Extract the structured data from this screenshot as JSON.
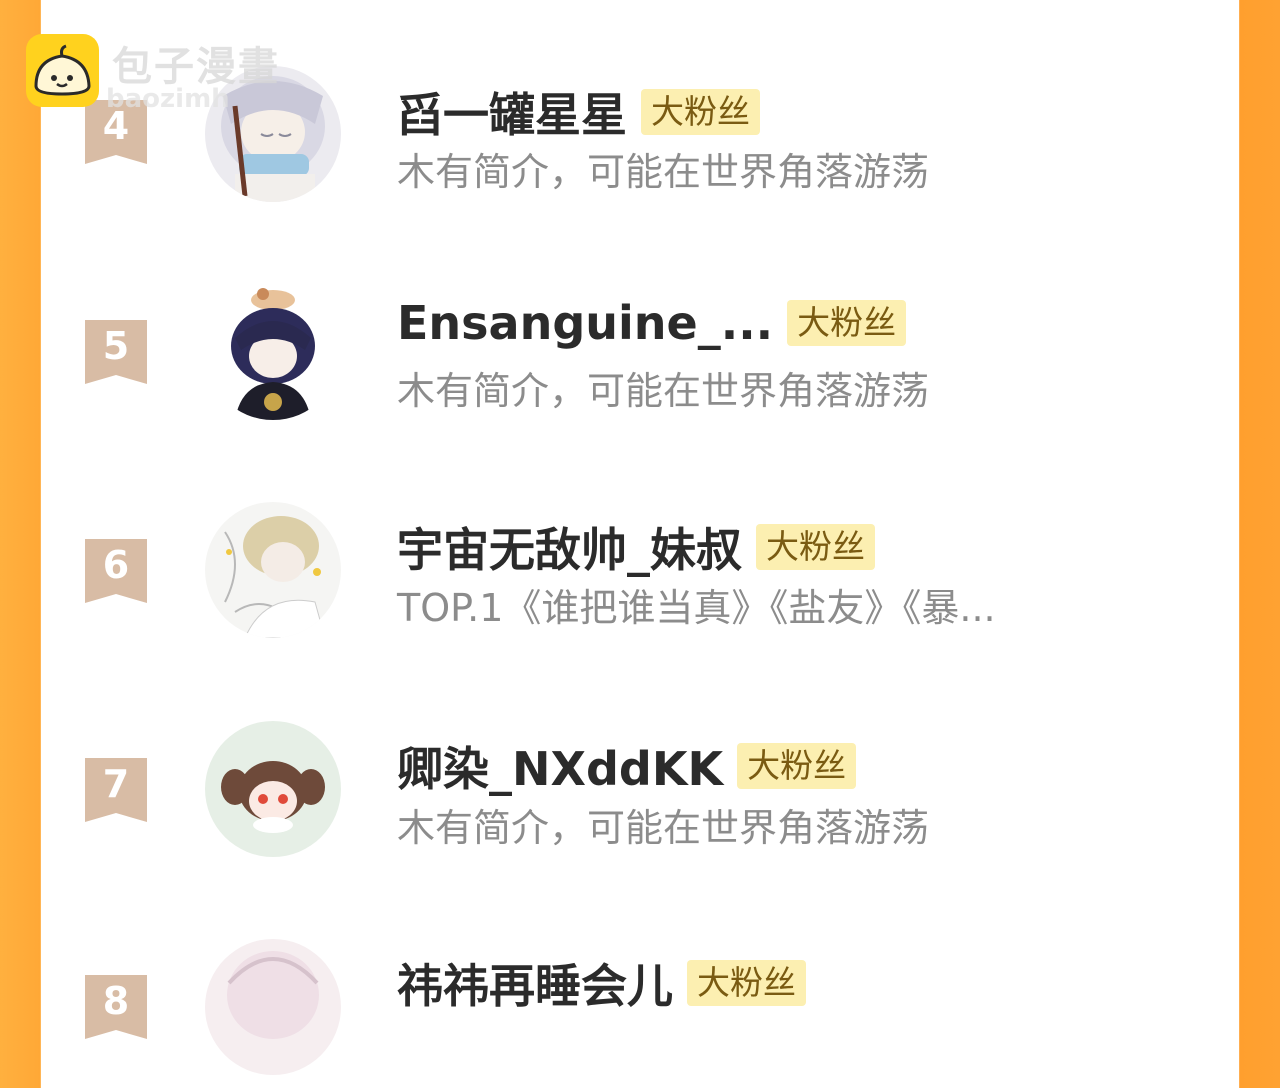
{
  "watermark": {
    "brand": "包子漫畫",
    "domain": "baozimh"
  },
  "rows": [
    {
      "rank": "4",
      "name": "舀一罐星星",
      "badge": "大粉丝",
      "bio": "木有简介，可能在世界角落游荡",
      "avatar": "avatar-silver-hair-elf-scarf"
    },
    {
      "rank": "5",
      "name": "Ensanguine_...",
      "badge": "大粉丝",
      "bio": "木有简介，可能在世界角落游荡",
      "avatar": "avatar-dark-hair-boy-with-cat"
    },
    {
      "rank": "6",
      "name": "宇宙无敌帅_妹叔",
      "badge": "大粉丝",
      "bio": "TOP.1《谁把谁当真》《盐友》《暴...",
      "avatar": "avatar-blond-boy-sketch"
    },
    {
      "rank": "7",
      "name": "卿染_NXddKK",
      "badge": "大粉丝",
      "bio": "木有简介，可能在世界角落游荡",
      "avatar": "avatar-crying-twin-tails-girl"
    },
    {
      "rank": "8",
      "name": "祎祎再睡会儿",
      "badge": "大粉丝",
      "bio": "",
      "avatar": "avatar-pink-hair-girl"
    }
  ],
  "colors": {
    "accent": "#ffa532",
    "badge_bg": "#fcefb1",
    "rank_ribbon": "#d4b79e"
  }
}
